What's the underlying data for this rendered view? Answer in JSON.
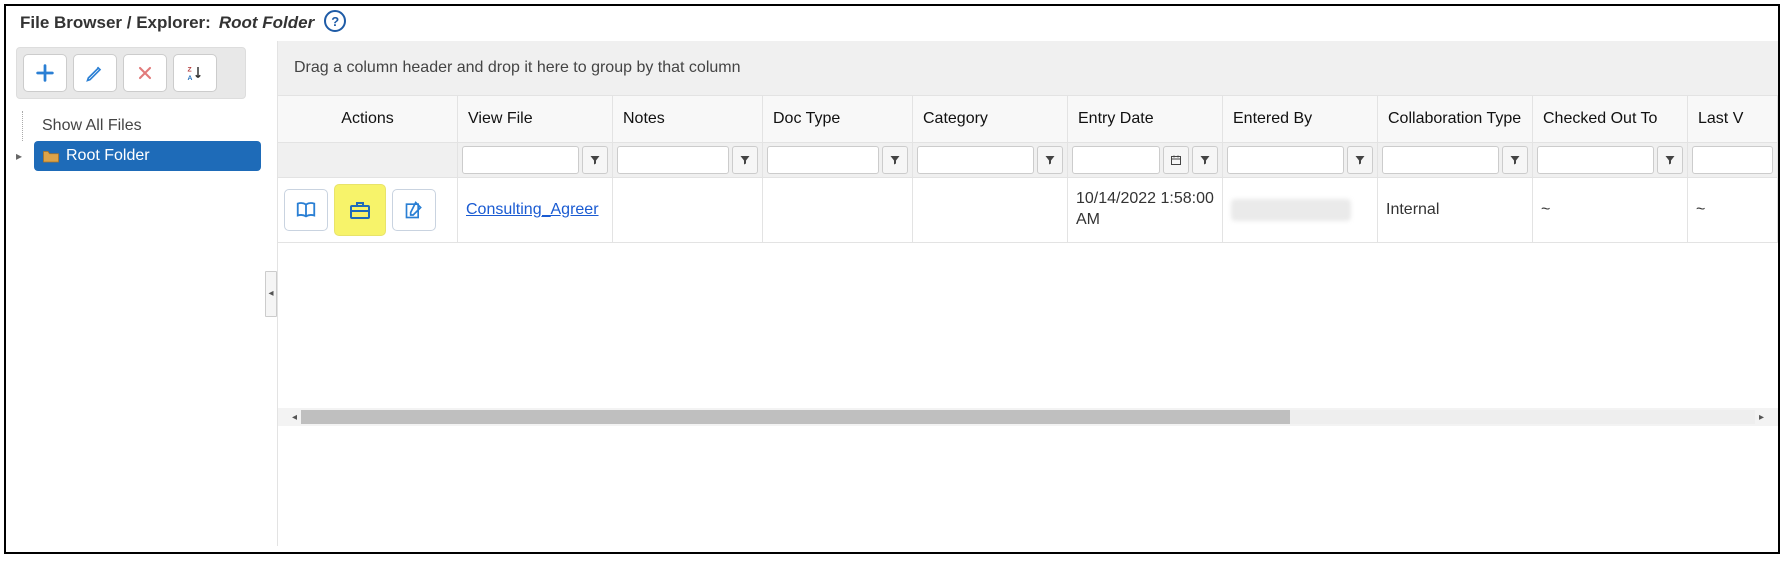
{
  "header": {
    "title_prefix": "File Browser / Explorer:",
    "location": "Root Folder"
  },
  "sidebar": {
    "show_all_label": "Show All Files",
    "root_label": "Root Folder"
  },
  "grid": {
    "group_hint": "Drag a column header and drop it here to group by that column",
    "columns": {
      "actions": "Actions",
      "view_file": "View File",
      "notes": "Notes",
      "doc_type": "Doc Type",
      "category": "Category",
      "entry_date": "Entry Date",
      "entered_by": "Entered By",
      "collab_type": "Collaboration Type",
      "checked_out": "Checked Out To",
      "last_v": "Last V"
    },
    "rows": [
      {
        "file_link": "Consulting_Agreer",
        "notes": "",
        "doc_type": "",
        "category": "",
        "entry_date": "10/14/2022 1:58:00 AM",
        "entered_by_redacted": true,
        "collab_type": "Internal",
        "checked_out": "~",
        "last_v": "~"
      }
    ]
  }
}
